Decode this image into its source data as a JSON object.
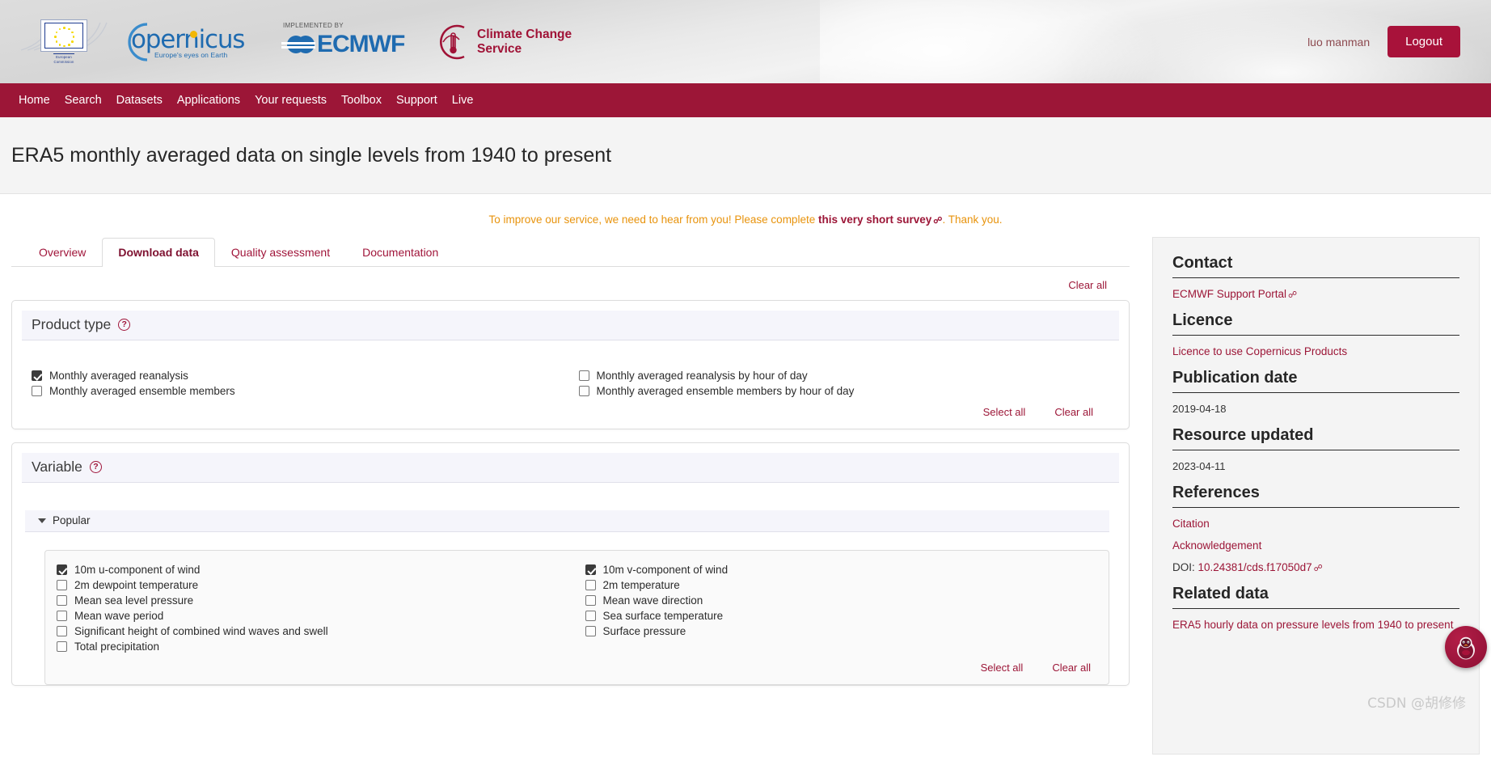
{
  "header": {
    "logos": [
      {
        "name": "european-commission-logo",
        "caption_line1": "European",
        "caption_line2": "Commission"
      },
      {
        "name": "copernicus-logo",
        "wordmark": "opernicus",
        "tagline": "Europe's eyes on Earth"
      },
      {
        "name": "ecmwf-logo",
        "kicker": "IMPLEMENTED BY",
        "wordmark": "ECMWF"
      },
      {
        "name": "c3s-logo",
        "line1": "Climate Change",
        "line2": "Service"
      }
    ],
    "username": "luo manman",
    "logout_label": "Logout"
  },
  "nav": {
    "items": [
      "Home",
      "Search",
      "Datasets",
      "Applications",
      "Your requests",
      "Toolbox",
      "Support",
      "Live"
    ]
  },
  "page": {
    "title": "ERA5 monthly averaged data on single levels from 1940 to present"
  },
  "survey": {
    "before": "To improve our service, we need to hear from you! Please complete ",
    "link": "this very short survey",
    "after": ". Thank you."
  },
  "tabs": [
    {
      "label": "Overview",
      "active": false
    },
    {
      "label": "Download data",
      "active": true
    },
    {
      "label": "Quality assessment",
      "active": false
    },
    {
      "label": "Documentation",
      "active": false
    }
  ],
  "form": {
    "clear_all_top": "Clear all",
    "select_all_label": "Select all",
    "clear_all_label": "Clear all",
    "sections": [
      {
        "name": "product-type",
        "title": "Product type",
        "help": "?",
        "columns": [
          [
            {
              "label": "Monthly averaged reanalysis",
              "checked": true
            },
            {
              "label": "Monthly averaged ensemble members",
              "checked": false
            }
          ],
          [
            {
              "label": "Monthly averaged reanalysis by hour of day",
              "checked": false
            },
            {
              "label": "Monthly averaged ensemble members by hour of day",
              "checked": false
            }
          ]
        ]
      },
      {
        "name": "variable",
        "title": "Variable",
        "help": "?",
        "accordion": {
          "label": "Popular",
          "expanded": true
        },
        "columns": [
          [
            {
              "label": "10m u-component of wind",
              "checked": true
            },
            {
              "label": "2m dewpoint temperature",
              "checked": false
            },
            {
              "label": "Mean sea level pressure",
              "checked": false
            },
            {
              "label": "Mean wave period",
              "checked": false
            },
            {
              "label": "Significant height of combined wind waves and swell",
              "checked": false
            },
            {
              "label": "Total precipitation",
              "checked": false
            }
          ],
          [
            {
              "label": "10m v-component of wind",
              "checked": true
            },
            {
              "label": "2m temperature",
              "checked": false
            },
            {
              "label": "Mean wave direction",
              "checked": false
            },
            {
              "label": "Sea surface temperature",
              "checked": false
            },
            {
              "label": "Surface pressure",
              "checked": false
            }
          ]
        ]
      }
    ]
  },
  "sidebar": {
    "blocks": [
      {
        "name": "contact",
        "heading": "Contact",
        "links": [
          {
            "text": "ECMWF Support Portal",
            "external": true
          }
        ]
      },
      {
        "name": "licence",
        "heading": "Licence",
        "links": [
          {
            "text": "Licence to use Copernicus Products",
            "external": false
          }
        ]
      },
      {
        "name": "publication-date",
        "heading": "Publication date",
        "value": "2019-04-18"
      },
      {
        "name": "resource-updated",
        "heading": "Resource updated",
        "value": "2023-04-11"
      },
      {
        "name": "references",
        "heading": "References",
        "links": [
          {
            "text": "Citation",
            "external": false
          },
          {
            "text": "Acknowledgement",
            "external": false
          }
        ],
        "doi_label": "DOI: ",
        "doi_value": "10.24381/cds.f17050d7"
      },
      {
        "name": "related-data",
        "heading": "Related data",
        "links": [
          {
            "text": "ERA5 hourly data on pressure levels from 1940 to present",
            "external": false
          }
        ]
      }
    ]
  },
  "watermark": {
    "text": "CSDN @胡修修"
  },
  "colors": {
    "brand_red": "#9c1637",
    "nav_bg": "#9c1637",
    "logout_bg": "#a8123a",
    "survey_orange": "#e8930c",
    "panel_head_bg": "#f5f5fb",
    "copernicus_blue": "#1f6bb0"
  }
}
